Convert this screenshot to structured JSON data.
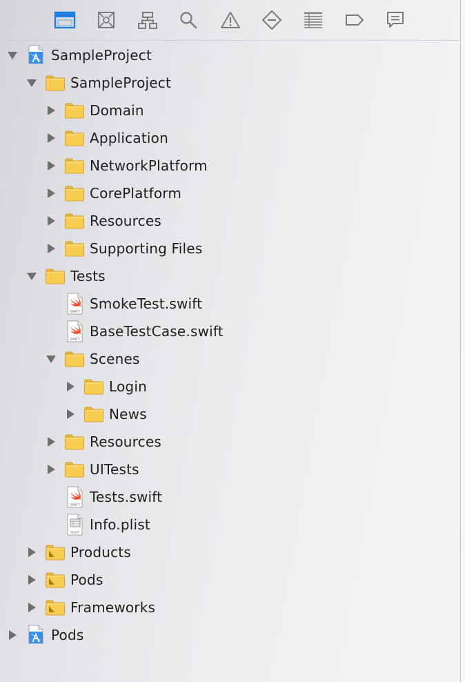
{
  "toolbar": {
    "icons": [
      {
        "name": "project-navigator-icon",
        "active": true
      },
      {
        "name": "source-control-icon",
        "active": false
      },
      {
        "name": "symbol-navigator-icon",
        "active": false
      },
      {
        "name": "find-icon",
        "active": false
      },
      {
        "name": "issue-icon",
        "active": false
      },
      {
        "name": "test-icon",
        "active": false
      },
      {
        "name": "debug-icon",
        "active": false
      },
      {
        "name": "breakpoint-icon",
        "active": false
      },
      {
        "name": "report-icon",
        "active": false
      }
    ]
  },
  "tree": [
    {
      "label": "SampleProject",
      "depth": 0,
      "kind": "project",
      "disclosure": "expanded"
    },
    {
      "label": "SampleProject",
      "depth": 1,
      "kind": "folder",
      "disclosure": "expanded"
    },
    {
      "label": "Domain",
      "depth": 2,
      "kind": "folder",
      "disclosure": "collapsed"
    },
    {
      "label": "Application",
      "depth": 2,
      "kind": "folder",
      "disclosure": "collapsed"
    },
    {
      "label": "NetworkPlatform",
      "depth": 2,
      "kind": "folder",
      "disclosure": "collapsed"
    },
    {
      "label": "CorePlatform",
      "depth": 2,
      "kind": "folder",
      "disclosure": "collapsed"
    },
    {
      "label": "Resources",
      "depth": 2,
      "kind": "folder",
      "disclosure": "collapsed"
    },
    {
      "label": "Supporting Files",
      "depth": 2,
      "kind": "folder",
      "disclosure": "collapsed"
    },
    {
      "label": "Tests",
      "depth": 1,
      "kind": "folder",
      "disclosure": "expanded"
    },
    {
      "label": "SmokeTest.swift",
      "depth": 2,
      "kind": "swift",
      "disclosure": "none"
    },
    {
      "label": "BaseTestCase.swift",
      "depth": 2,
      "kind": "swift",
      "disclosure": "none"
    },
    {
      "label": "Scenes",
      "depth": 2,
      "kind": "folder",
      "disclosure": "expanded"
    },
    {
      "label": "Login",
      "depth": 3,
      "kind": "folder",
      "disclosure": "collapsed"
    },
    {
      "label": "News",
      "depth": 3,
      "kind": "folder",
      "disclosure": "collapsed"
    },
    {
      "label": "Resources",
      "depth": 2,
      "kind": "folder",
      "disclosure": "collapsed"
    },
    {
      "label": "UITests",
      "depth": 2,
      "kind": "folder",
      "disclosure": "collapsed"
    },
    {
      "label": "Tests.swift",
      "depth": 2,
      "kind": "swift",
      "disclosure": "none"
    },
    {
      "label": "Info.plist",
      "depth": 2,
      "kind": "plist",
      "disclosure": "none"
    },
    {
      "label": "Products",
      "depth": 1,
      "kind": "group-folder",
      "disclosure": "collapsed"
    },
    {
      "label": "Pods",
      "depth": 1,
      "kind": "group-folder",
      "disclosure": "collapsed"
    },
    {
      "label": "Frameworks",
      "depth": 1,
      "kind": "group-folder",
      "disclosure": "collapsed"
    },
    {
      "label": "Pods",
      "depth": 0,
      "kind": "project",
      "disclosure": "collapsed"
    }
  ],
  "file_badges": {
    "swift": "SWIFT",
    "plist": "PLIST"
  },
  "colors": {
    "accent": "#1f7fe0",
    "icon_gray": "#7a7a7a",
    "folder_fill": "#f8cd52",
    "folder_tab": "#eab63c",
    "folder_stroke": "#d2a232",
    "disclosure": "#6e6e6e",
    "swift_orange": "#f05138",
    "text": "#1e1e1e"
  }
}
